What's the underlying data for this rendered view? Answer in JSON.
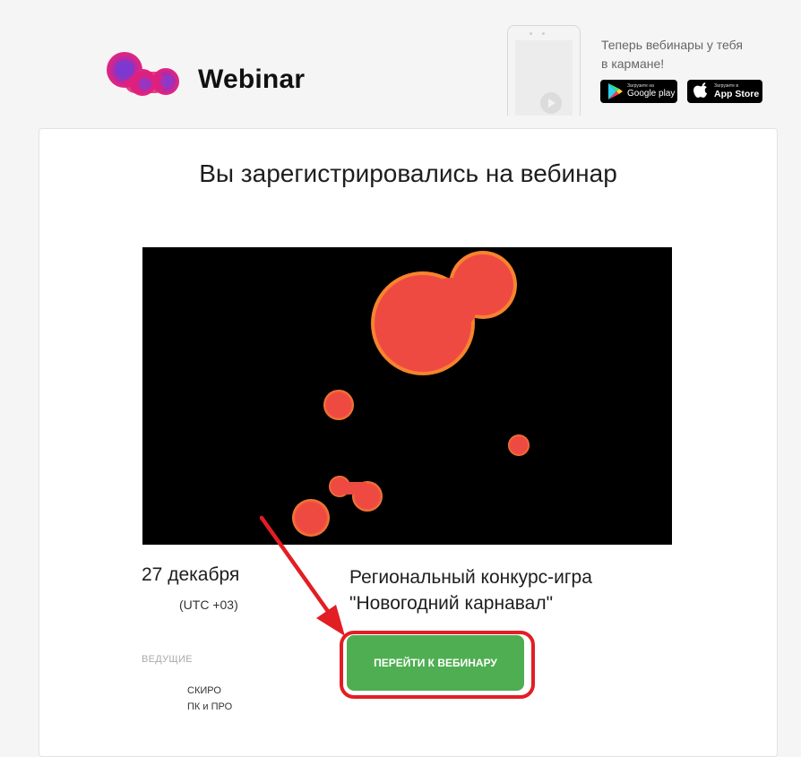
{
  "header": {
    "brand_name": "Webinar",
    "promo_line_1": "Теперь вебинары у тебя",
    "promo_line_2": "в кармане!",
    "google_play": {
      "small": "Загрузите на",
      "big": "Google play",
      "icon": "google-play-icon"
    },
    "app_store": {
      "small": "Загрузите в",
      "big": "App Store",
      "icon": "apple-icon"
    }
  },
  "main": {
    "title": "Вы зарегистрировались на вебинар",
    "date": "27 декабря",
    "timezone": "(UTC +03)",
    "event_title_line_1": "Региональный конкурс-игра",
    "event_title_line_2": "\"Новогодний карнавал\"",
    "hosts_label": "ВЕДУЩИЕ",
    "hosts": [
      "СКИРО",
      "ПК и ПРО"
    ],
    "join_button": "ПЕРЕЙТИ К ВЕБИНАРУ"
  },
  "colors": {
    "accent_green": "#4fae52",
    "annotation_red": "#e21e24",
    "blob_orange": "#f05a3c",
    "logo_magenta": "#e0207a"
  }
}
